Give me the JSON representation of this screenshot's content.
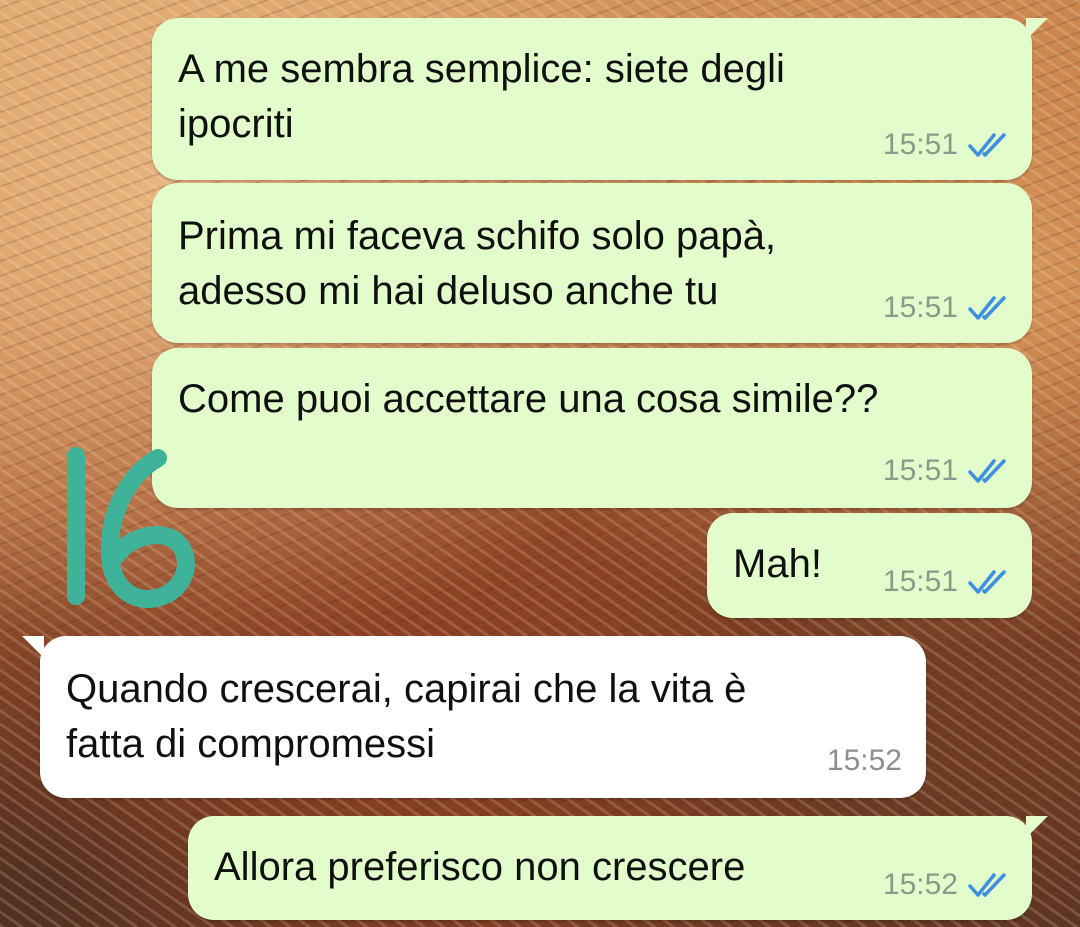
{
  "messages": [
    {
      "direction": "out",
      "text": "A me sembra semplice: siete degli\nipocriti",
      "time": "15:51",
      "status": "read"
    },
    {
      "direction": "out",
      "text": "Prima mi faceva schifo solo papà,\nadesso mi hai deluso anche tu",
      "time": "15:51",
      "status": "read"
    },
    {
      "direction": "out",
      "text": "Come puoi accettare una cosa simile??",
      "time": "15:51",
      "status": "read"
    },
    {
      "direction": "out",
      "text": "Mah!",
      "time": "15:51",
      "status": "read"
    },
    {
      "direction": "in",
      "text": "Quando crescerai, capirai che la vita è\nfatta di compromessi",
      "time": "15:52"
    },
    {
      "direction": "out",
      "text": "Allora preferisco non crescere",
      "time": "15:52",
      "status": "read"
    }
  ],
  "colors": {
    "outgoing_bubble": "#e2fdcb",
    "incoming_bubble": "#ffffff",
    "read_ticks": "#3d8fe0",
    "sticker": "#3fb39a"
  },
  "annotation": {
    "text": "16",
    "kind": "hand-drawn sticker"
  }
}
